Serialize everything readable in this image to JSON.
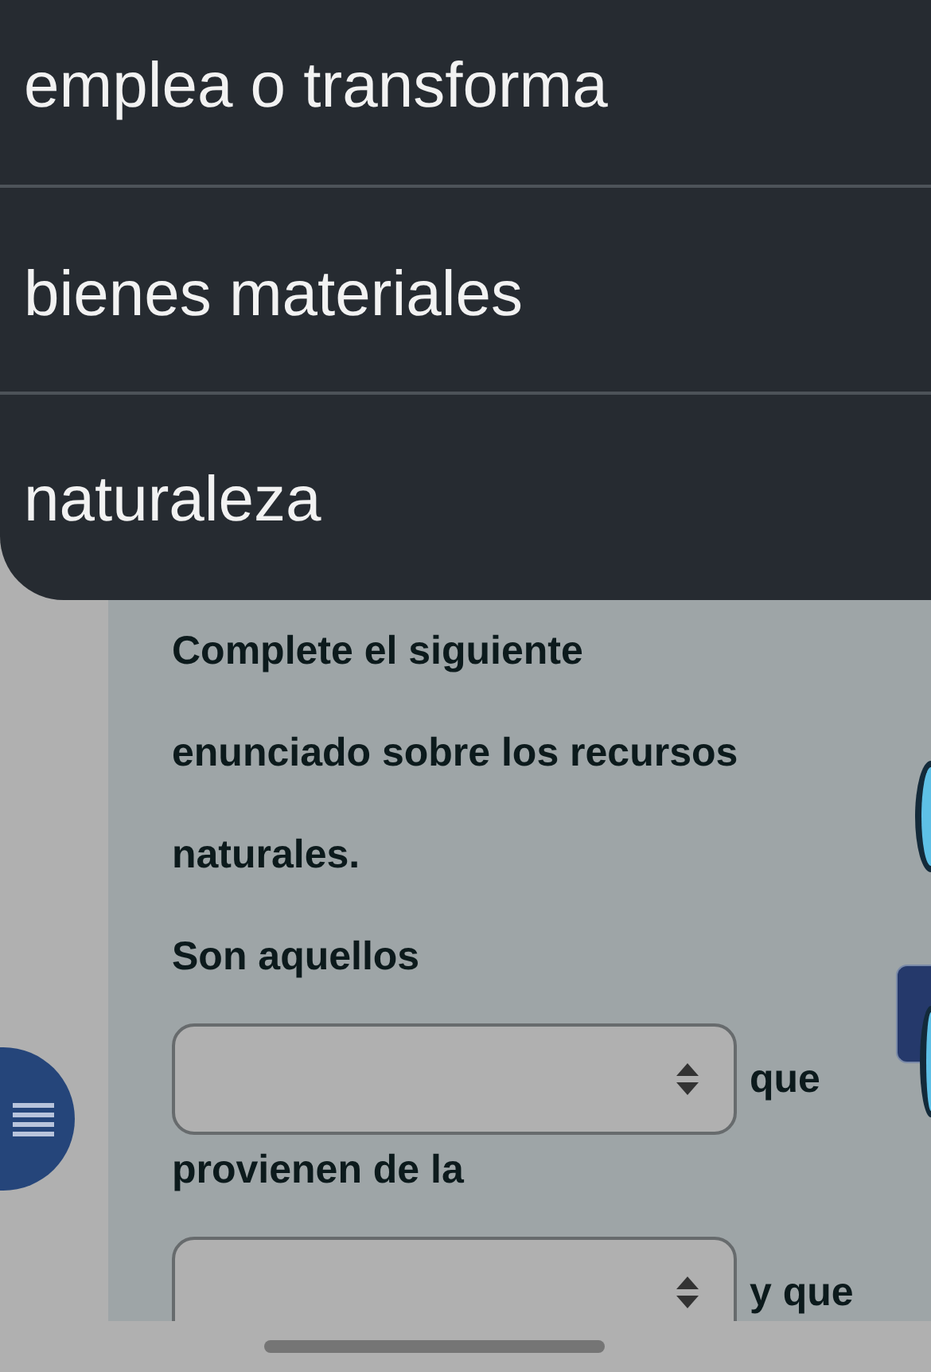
{
  "dropdown_menu": {
    "options": [
      {
        "label": "emplea o transforma"
      },
      {
        "label": "bienes materiales"
      },
      {
        "label": "naturaleza"
      }
    ]
  },
  "question": {
    "prompt": [
      "Complete el siguiente",
      "enunciado sobre los recursos",
      "naturales."
    ],
    "blanks": [
      {
        "kind": "text",
        "text": "Son aquellos"
      },
      {
        "kind": "select"
      },
      {
        "kind": "text",
        "text": "que"
      },
      {
        "kind": "text",
        "text": "provienen de la"
      },
      {
        "kind": "select"
      },
      {
        "kind": "text",
        "text": "y que"
      }
    ]
  }
}
